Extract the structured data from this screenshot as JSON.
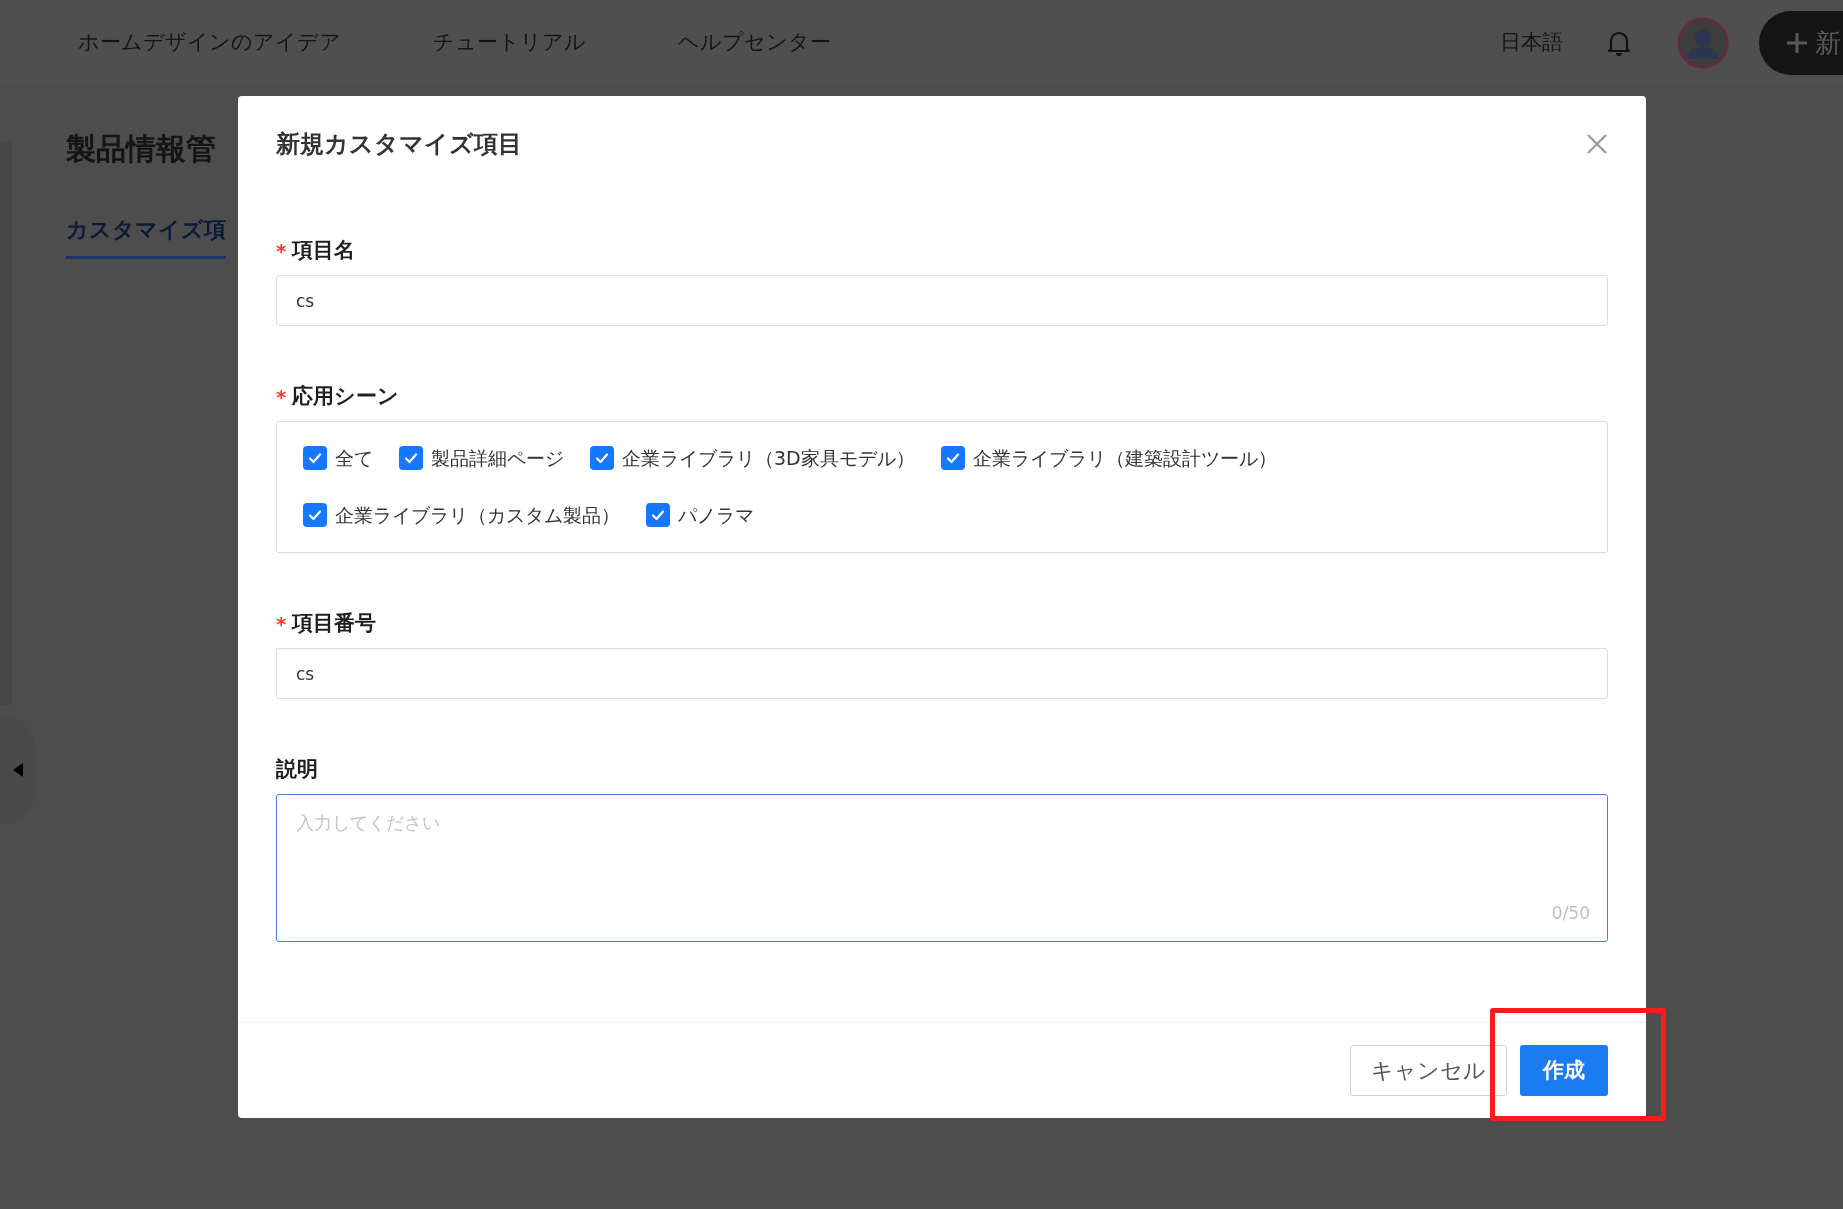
{
  "nav": {
    "links": [
      "ホームデザインのアイデア",
      "チュートリアル",
      "ヘルプセンター"
    ],
    "language": "日本語",
    "new_button": "新"
  },
  "page": {
    "title": "製品情報管",
    "tabs": [
      {
        "label": "カスタマイズ項",
        "selected": true
      }
    ]
  },
  "dialog": {
    "title": "新規カスタマイズ項目",
    "fields": [
      {
        "kind": "text",
        "label": "項目名",
        "required_mark": "*",
        "value": "cs"
      },
      {
        "kind": "checks",
        "label": "応用シーン",
        "required_mark": "*",
        "options": [
          {
            "label": "全て",
            "checked": true
          },
          {
            "label": "製品詳細ページ",
            "checked": true
          },
          {
            "label": "企業ライブラリ（3D家具モデル）",
            "checked": true
          },
          {
            "label": "企業ライブラリ（建築設計ツール）",
            "checked": true
          },
          {
            "label": "企業ライブラリ（カスタム製品）",
            "checked": true
          },
          {
            "label": "パノラマ",
            "checked": true
          }
        ]
      },
      {
        "kind": "text",
        "label": "項目番号",
        "required_mark": "*",
        "value": "cs"
      },
      {
        "kind": "textarea",
        "label": "説明",
        "placeholder": "入力してください",
        "counter": "0/50",
        "focused": true
      }
    ],
    "buttons": [
      {
        "label": "キャンセル",
        "kind": "secondary"
      },
      {
        "label": "作成",
        "kind": "primary"
      }
    ]
  }
}
